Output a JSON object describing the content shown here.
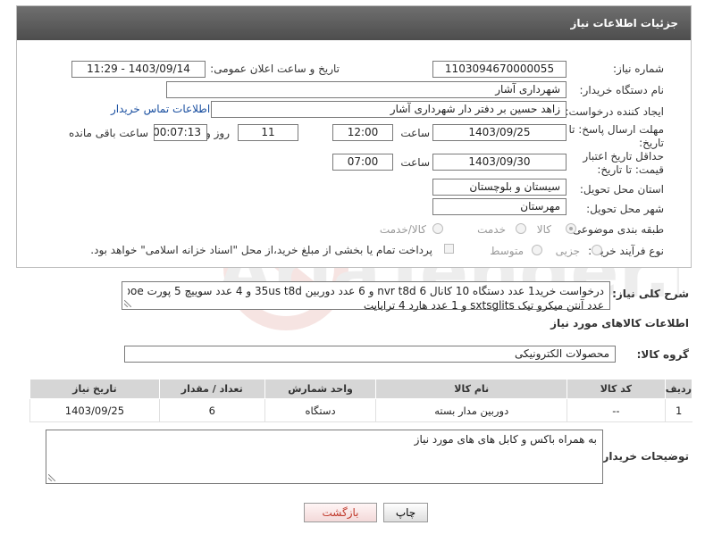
{
  "header": {
    "title": "جزئیات اطلاعات نیاز"
  },
  "labels": {
    "need_number": "شماره نیاز:",
    "announce_datetime": "تاریخ و ساعت اعلان عمومی:",
    "buyer_org": "نام دستگاه خریدار:",
    "requester": "ایجاد کننده درخواست:",
    "reply_deadline": "مهلت ارسال پاسخ: تا تاریخ:",
    "validity_deadline": "حداقل تاریخ اعتبار قیمت: تا تاریخ:",
    "province": "استان محل تحویل:",
    "city": "شهر محل تحویل:",
    "category": "طبقه بندی موضوعی:",
    "process_type": "نوع فرآیند خرید :",
    "time": "ساعت",
    "day_and": "روز و",
    "remaining": "ساعت باقی مانده",
    "general_desc": "شرح کلی نیاز:",
    "goods_info": "اطلاعات کالاهای مورد نیاز",
    "goods_group": "گروه کالا:",
    "buyer_notes": "توضیحات خریدار:"
  },
  "fields": {
    "need_number": "1103094670000055",
    "announce_datetime": "1403/09/14 - 11:29",
    "buyer_org": "شهرداری آشار",
    "requester": "زاهد حسین بر دفتر دار شهرداری آشار",
    "contact_link": "اطلاعات تماس خریدار",
    "reply_date": "1403/09/25",
    "reply_time": "12:00",
    "reply_days": "11",
    "reply_remaining": "00:07:13",
    "validity_date": "1403/09/30",
    "validity_time": "07:00",
    "province": "سیستان و بلوچستان",
    "city": "مهرستان"
  },
  "category_options": [
    "کالا",
    "خدمت",
    "کالا/خدمت"
  ],
  "process_options": [
    "جزیی",
    "متوسط"
  ],
  "payment_note": "پرداخت تمام یا بخشی از مبلغ خرید،از محل \"اسناد خزانه اسلامی\" خواهد بود.",
  "description_lines": [
    "درخواست خرید1 عدد دستگاه 10 کانال nvr t8d 6 و 6 عدد دوربین 35us t8d و 4 عدد سوییچ 5 پورت poe و 6",
    "عدد آنتن میکرو تیک sxtsglits و 1 عدد هارد 4 ترابایت"
  ],
  "goods_group": "محصولات الکترونیکی",
  "table": {
    "headers": [
      "ردیف",
      "کد کالا",
      "نام کالا",
      "واحد شمارش",
      "تعداد / مقدار",
      "تاریخ نیاز"
    ],
    "rows": [
      [
        "1",
        "--",
        "دوربین مدار بسته",
        "دستگاه",
        "6",
        "1403/09/25"
      ]
    ]
  },
  "buyer_notes": "به همراه  باکس  و کابل های های مورد نیاز",
  "buttons": {
    "print": "چاپ",
    "back": "بازگشت"
  },
  "watermark_text": "AriaTender.neT"
}
